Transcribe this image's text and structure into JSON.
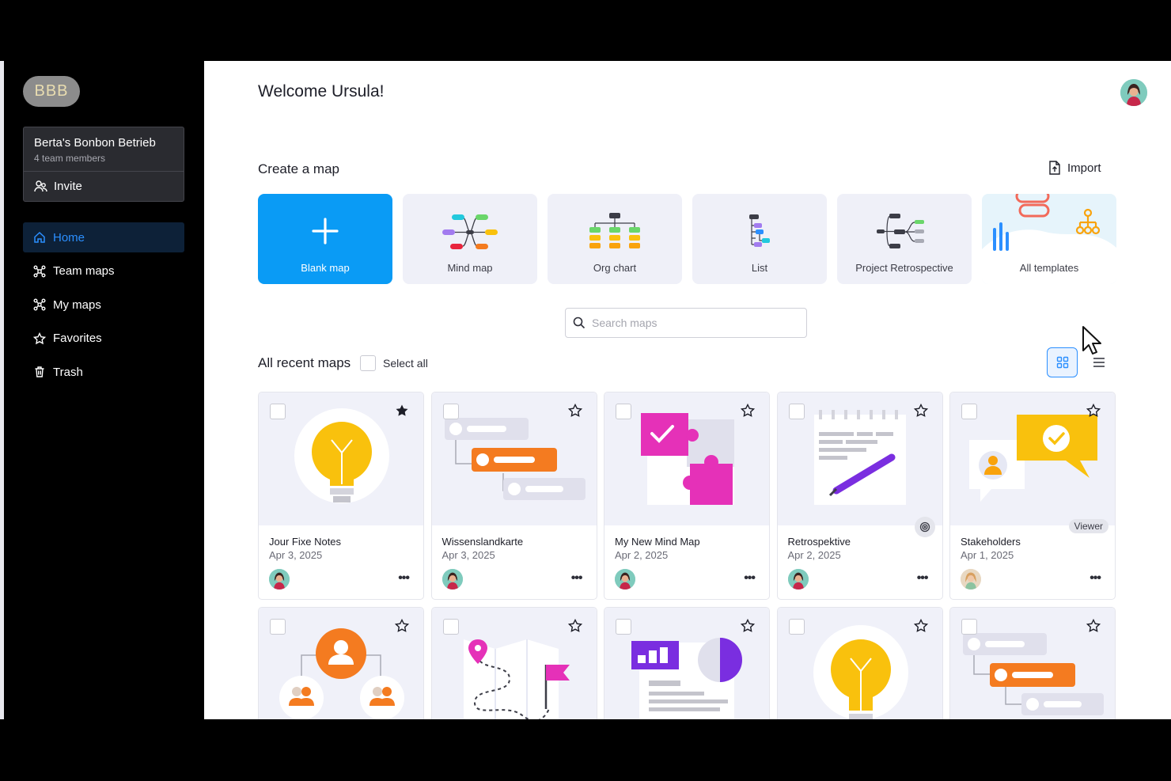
{
  "sidebar": {
    "logo": "BBB",
    "team": {
      "name": "Berta's Bonbon Betrieb",
      "members": "4 team members",
      "invite": "Invite"
    },
    "nav": [
      {
        "label": "Home",
        "icon": "home-icon",
        "active": true
      },
      {
        "label": "Team maps",
        "icon": "team-maps-icon"
      },
      {
        "label": "My maps",
        "icon": "my-maps-icon"
      },
      {
        "label": "Favorites",
        "icon": "star-icon"
      },
      {
        "label": "Trash",
        "icon": "trash-icon"
      }
    ]
  },
  "header": {
    "welcome": "Welcome Ursula!"
  },
  "create": {
    "title": "Create a map",
    "import": "Import",
    "tiles": [
      {
        "label": "Blank map"
      },
      {
        "label": "Mind map"
      },
      {
        "label": "Org chart"
      },
      {
        "label": "List"
      },
      {
        "label": "Project Retrospective"
      },
      {
        "label": "All templates"
      }
    ]
  },
  "search": {
    "placeholder": "Search maps"
  },
  "recent": {
    "title": "All recent maps",
    "select_all": "Select all",
    "cards": [
      {
        "name": "Jour Fixe Notes",
        "date": "Apr 3, 2025",
        "starred": true
      },
      {
        "name": "Wissenslandkarte",
        "date": "Apr 3, 2025",
        "starred": false
      },
      {
        "name": "My New Mind Map",
        "date": "Apr 2, 2025",
        "starred": false
      },
      {
        "name": "Retrospektive",
        "date": "Apr 2, 2025",
        "starred": false
      },
      {
        "name": "Stakeholders",
        "date": "Apr 1, 2025",
        "starred": false,
        "badge": "Viewer"
      }
    ]
  },
  "colors": {
    "accent": "#0a9bf5",
    "active_nav": "#2b8fff",
    "orange": "#f47b20",
    "yellow": "#f9c10d",
    "magenta": "#e531b8",
    "purple": "#7a2ee0"
  }
}
